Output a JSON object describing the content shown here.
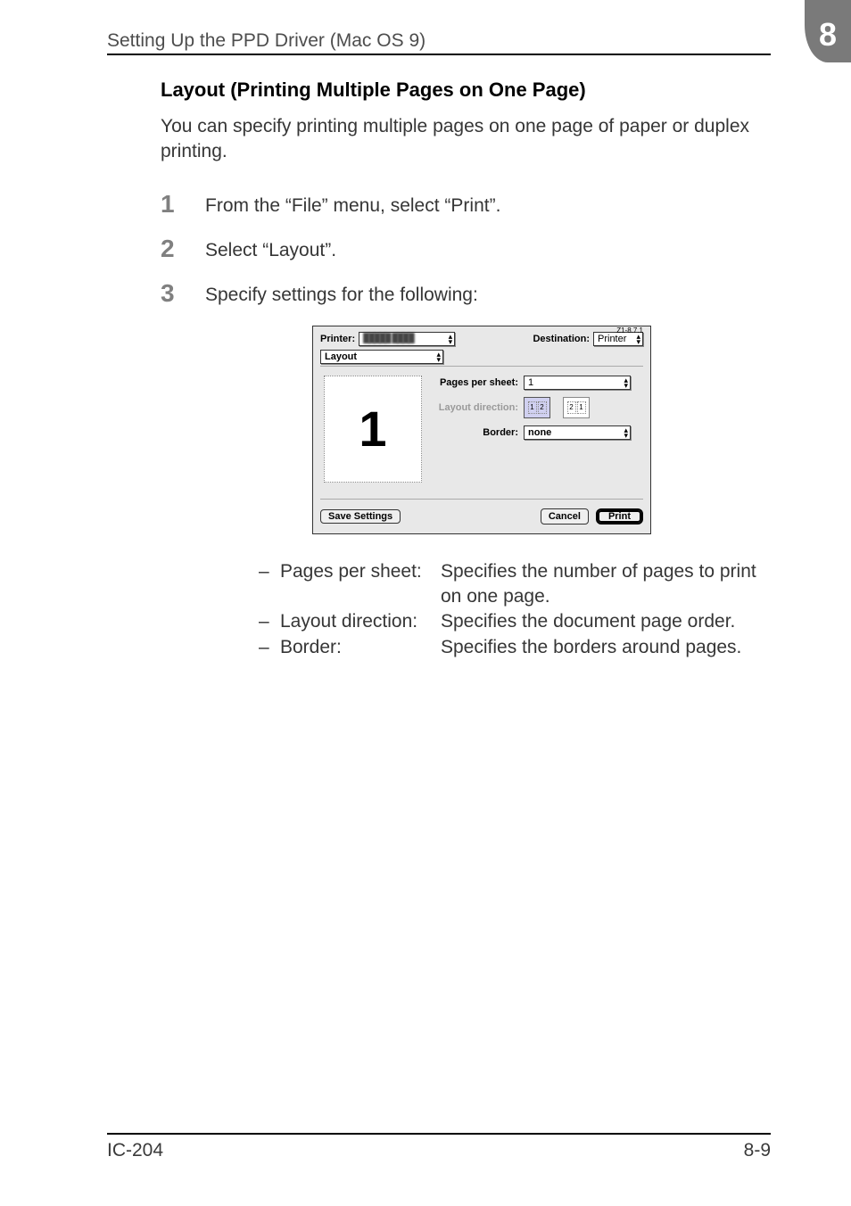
{
  "header": {
    "running_title": "Setting Up the PPD Driver (Mac OS 9)",
    "chapter_number": "8"
  },
  "section": {
    "title": "Layout (Printing Multiple Pages on One Page)",
    "intro": "You can specify printing multiple pages on one page of paper or duplex printing."
  },
  "steps": [
    {
      "num": "1",
      "text": "From the “File” menu, select “Print”."
    },
    {
      "num": "2",
      "text": "Select “Layout”."
    },
    {
      "num": "3",
      "text": "Specify settings for the following:"
    }
  ],
  "dialog": {
    "version": "Z1-8.7.1",
    "printer_label": "Printer:",
    "printer_value": "█████ ████",
    "destination_label": "Destination:",
    "destination_value": "Printer",
    "section_value": "Layout",
    "pps_label": "Pages per sheet:",
    "pps_value": "1",
    "dir_label": "Layout direction:",
    "dir_lr": [
      "1",
      "2"
    ],
    "dir_rl": [
      "2",
      "1"
    ],
    "border_label": "Border:",
    "border_value": "none",
    "preview_glyph": "1",
    "save_btn": "Save Settings",
    "cancel_btn": "Cancel",
    "print_btn": "Print"
  },
  "definitions": [
    {
      "term": "Pages per sheet:",
      "desc": "Specifies the number of pages to print on one page."
    },
    {
      "term": "Layout direction:",
      "desc": "Specifies the document page order."
    },
    {
      "term": "Border:",
      "desc": "Specifies the borders around pages."
    }
  ],
  "footer": {
    "left": "IC-204",
    "right": "8-9"
  }
}
